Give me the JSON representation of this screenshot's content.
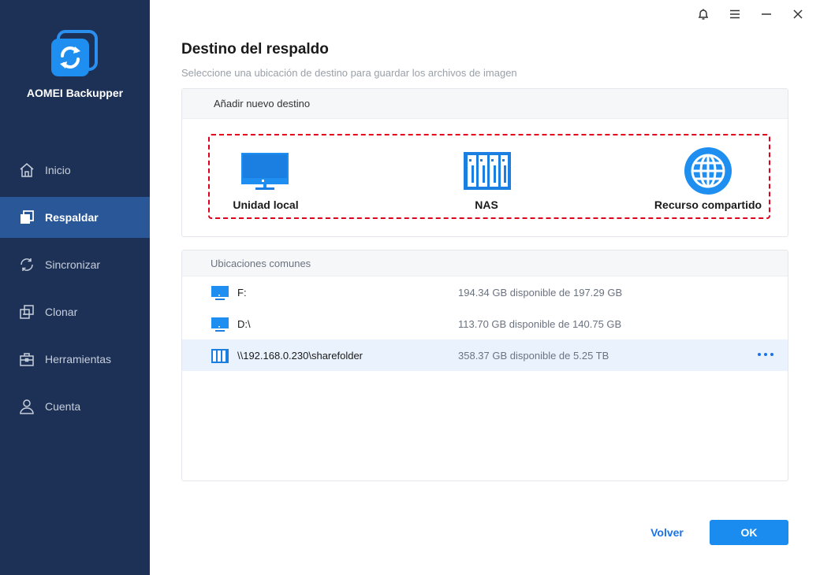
{
  "app": {
    "name": "AOMEI Backupper",
    "logo_icon": "aomei-logo-icon"
  },
  "window_controls": [
    {
      "icon": "bell-icon"
    },
    {
      "icon": "menu-icon"
    },
    {
      "icon": "minimize-icon"
    },
    {
      "icon": "close-icon"
    }
  ],
  "sidebar": {
    "items": [
      {
        "label": "Inicio",
        "icon": "home-icon",
        "active": false
      },
      {
        "label": "Respaldar",
        "icon": "backup-icon",
        "active": true
      },
      {
        "label": "Sincronizar",
        "icon": "sync-icon",
        "active": false
      },
      {
        "label": "Clonar",
        "icon": "clone-icon",
        "active": false
      },
      {
        "label": "Herramientas",
        "icon": "toolbox-icon",
        "active": false
      },
      {
        "label": "Cuenta",
        "icon": "user-icon",
        "active": false
      }
    ]
  },
  "main": {
    "title": "Destino del respaldo",
    "subtitle": "Seleccione una ubicación de destino para guardar los archivos de imagen",
    "add_destination": {
      "heading": "Añadir nuevo destino",
      "options": [
        {
          "label": "Unidad local",
          "icon": "monitor-icon"
        },
        {
          "label": "NAS",
          "icon": "nas-icon"
        },
        {
          "label": "Recurso compartido",
          "icon": "globe-icon"
        }
      ]
    },
    "common_locations": {
      "heading": "Ubicaciones comunes",
      "rows": [
        {
          "name": "F:",
          "capacity": "194.34 GB disponible de 197.29 GB",
          "icon": "drive-icon",
          "selected": false
        },
        {
          "name": "D:\\",
          "capacity": "113.70 GB disponible de 140.75 GB",
          "icon": "drive-icon",
          "selected": false
        },
        {
          "name": "\\\\192.168.0.230\\sharefolder",
          "capacity": "358.37 GB disponible de 5.25 TB",
          "icon": "nas-icon",
          "selected": true
        }
      ]
    }
  },
  "footer": {
    "back_label": "Volver",
    "ok_label": "OK"
  },
  "colors": {
    "sidebar_bg": "#1d3157",
    "sidebar_active": "#2a5797",
    "accent": "#1a8cf0",
    "highlight_border": "#e0001b"
  }
}
